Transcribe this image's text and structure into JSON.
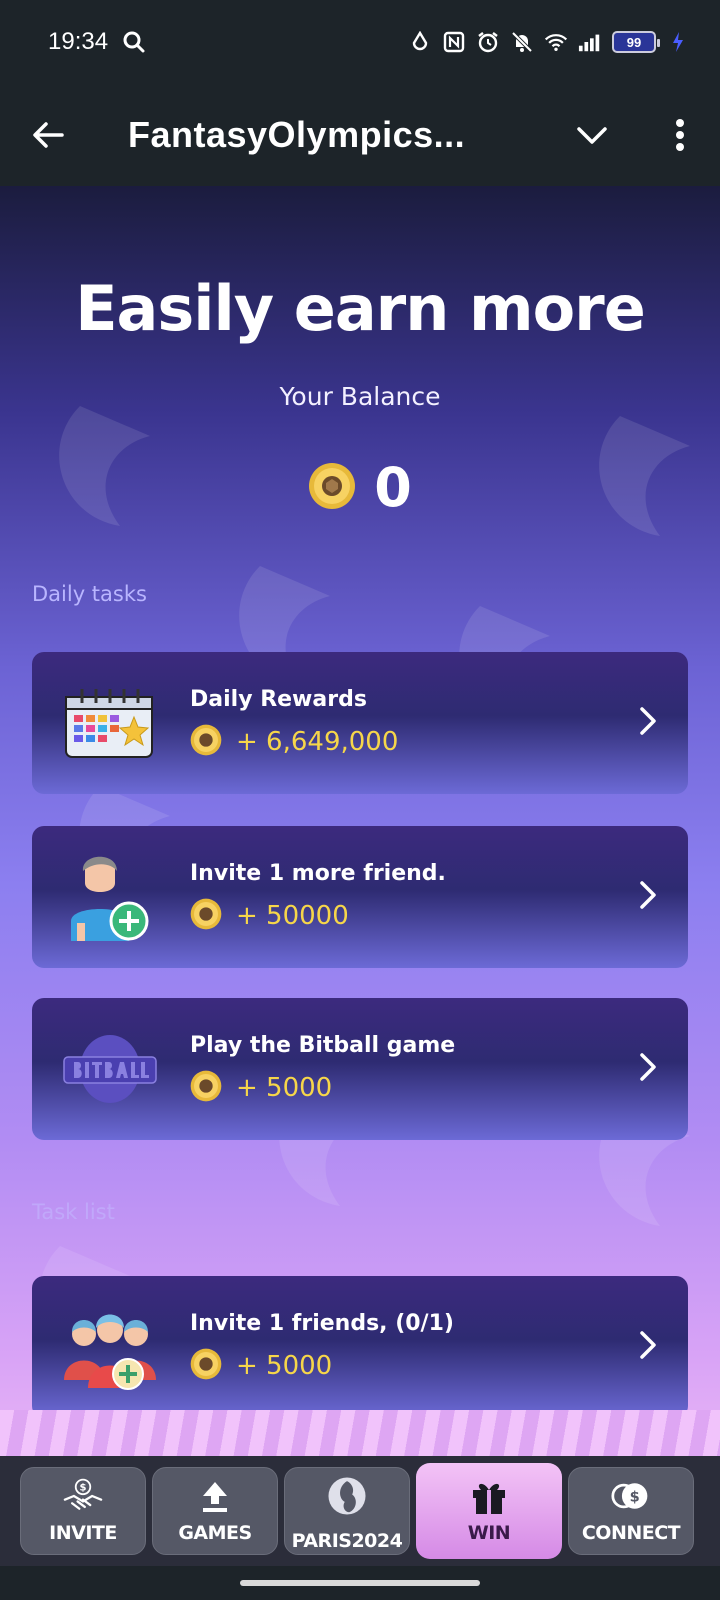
{
  "status_bar": {
    "time": "19:34",
    "battery": "99"
  },
  "app_bar": {
    "title": "FantasyOlympics..."
  },
  "hero": {
    "title": "Easily earn more",
    "balance_label": "Your Balance",
    "balance_value": "0"
  },
  "sections": {
    "daily": "Daily tasks",
    "task_list": "Task list"
  },
  "daily_tasks": [
    {
      "title": "Daily Rewards",
      "reward": "+ 6,649,000",
      "icon": "calendar-icon"
    },
    {
      "title": "Invite 1 more friend.",
      "reward": "+ 50000",
      "icon": "add-user-icon"
    },
    {
      "title": "Play the Bitball game",
      "reward": "+ 5000",
      "icon": "bitball-logo-icon"
    }
  ],
  "task_list": [
    {
      "title": "Invite 1 friends, (0/1)",
      "reward": "+ 5000",
      "icon": "group-add-icon"
    }
  ],
  "bottom_nav": [
    {
      "label": "INVITE",
      "icon": "handshake-dollar-icon"
    },
    {
      "label": "GAMES",
      "icon": "upload-icon"
    },
    {
      "label": "PARIS2024",
      "icon": "flame-face-icon"
    },
    {
      "label": "WIN",
      "icon": "gift-icon",
      "active": true
    },
    {
      "label": "CONNECT",
      "icon": "coins-icon"
    }
  ],
  "colors": {
    "reward_text": "#f6d64a",
    "section_label": "#b9b5ff",
    "active_tab": "#e0a2ee",
    "bar_bg": "#1d2429"
  }
}
